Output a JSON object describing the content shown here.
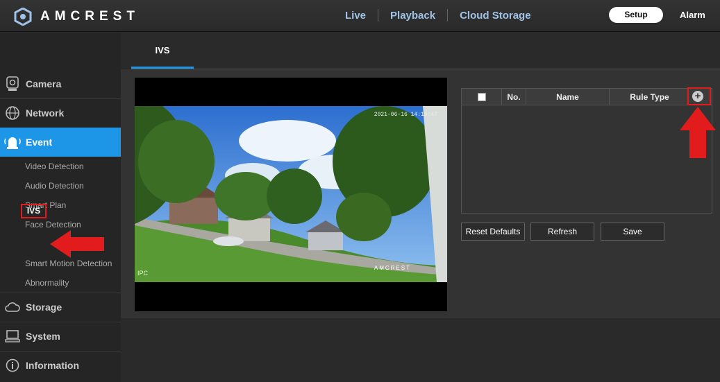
{
  "brand": {
    "name": "AMCREST"
  },
  "topnav": {
    "items": [
      "Live",
      "Playback",
      "Cloud Storage"
    ],
    "setup": "Setup",
    "alarm": "Alarm"
  },
  "sidebar": {
    "sections": [
      {
        "label": "Camera",
        "icon": "camera-icon"
      },
      {
        "label": "Network",
        "icon": "globe-icon"
      },
      {
        "label": "Event",
        "icon": "alarm-bell-icon",
        "active": true
      },
      {
        "label": "Storage",
        "icon": "cloud-icon"
      },
      {
        "label": "System",
        "icon": "monitor-icon"
      },
      {
        "label": "Information",
        "icon": "info-icon"
      }
    ],
    "event_items": [
      "Video Detection",
      "Audio Detection",
      "Smart Plan",
      "Face Detection",
      "IVS",
      "Smart Motion Detection",
      "Abnormality"
    ],
    "selected_item": "IVS"
  },
  "tab": {
    "label": "IVS"
  },
  "video": {
    "osd_time": "2021-06-16 14:15:47",
    "osd_name": "IPC",
    "watermark": "AMCREST"
  },
  "table": {
    "headers": [
      "No.",
      "Name",
      "Rule Type"
    ],
    "rows": [],
    "add_icon": "plus-circle-icon"
  },
  "buttons": {
    "reset": "Reset Defaults",
    "refresh": "Refresh",
    "save": "Save"
  },
  "colors": {
    "accent": "#1e96e8",
    "highlight": "#e21c1c"
  }
}
